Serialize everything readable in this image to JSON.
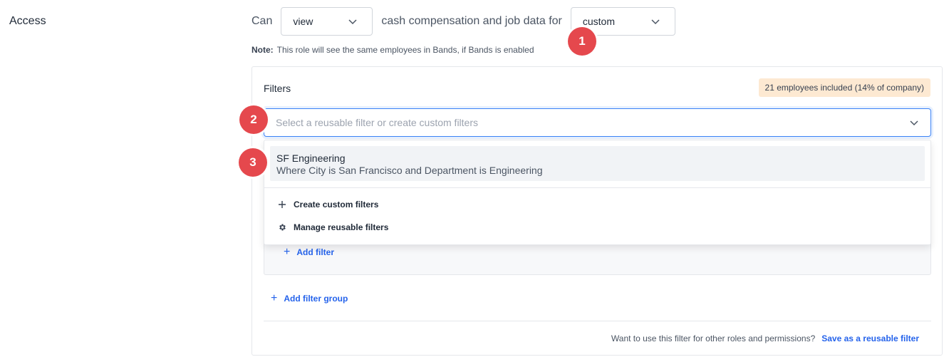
{
  "section": {
    "label": "Access"
  },
  "sentence": {
    "can": "Can",
    "permission_value": "view",
    "middle": "cash compensation and job data for",
    "scope_value": "custom"
  },
  "note": {
    "label": "Note:",
    "text": "This role will see the same employees in Bands, if Bands is enabled"
  },
  "markers": [
    "1",
    "2",
    "3"
  ],
  "filters": {
    "title": "Filters",
    "count_badge": "21 employees included (14% of company)",
    "select_placeholder": "Select a reusable filter or create custom filters",
    "add_filter_label": "Add filter",
    "add_group_label": "Add filter group",
    "footer_text": "Want to use this filter for other roles and permissions?",
    "footer_link": "Save as a reusable filter"
  },
  "dropdown": {
    "options": [
      {
        "name": "SF Engineering",
        "description": "Where City is San Francisco and Department is Engineering"
      }
    ],
    "actions": [
      {
        "label": "Create custom filters",
        "icon": "plus-icon"
      },
      {
        "label": "Manage reusable filters",
        "icon": "gear-icon"
      }
    ]
  },
  "colors": {
    "accent": "#2563eb",
    "focus_border": "#3b82f6",
    "marker": "#e5484d",
    "count_badge_bg": "#fde9d2"
  }
}
